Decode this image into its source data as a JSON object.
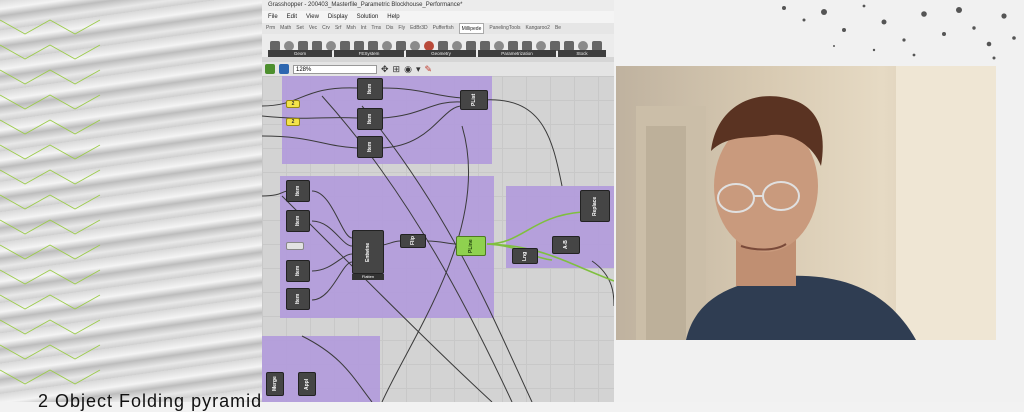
{
  "window": {
    "title": "Grasshopper - 200403_Masterfile_Parametric Blockhouse_Performance*"
  },
  "menu": [
    "File",
    "Edit",
    "View",
    "Display",
    "Solution",
    "Help"
  ],
  "tabs": [
    "Prm",
    "Math",
    "Set",
    "Vec",
    "Crv",
    "Srf",
    "Msh",
    "Int",
    "Trns",
    "Dis",
    "Fly",
    "EdBr3D",
    "Pufferfish",
    "Millipede",
    "PanelingTools",
    "Kangaroo2",
    "Be"
  ],
  "active_tab": "Millipede",
  "ribbon_groups": [
    "Geom",
    "FESystem",
    "Geometry",
    "Parametrization",
    "Stock"
  ],
  "canvas_toolbar": {
    "zoom": "128%"
  },
  "components": {
    "item_label": "Item",
    "explode_label": "Entwine",
    "explode_caption": "Flatten",
    "flip_label": "Flip",
    "pline_label": "PLine",
    "plist_label": "PList",
    "replace_label": "Replace",
    "ab_label": "A-B",
    "lng_label": "Lng",
    "merge_label": "Merge",
    "appl_label": "Appl",
    "number_label": "2"
  },
  "caption": "2 Object Folding pyramid"
}
